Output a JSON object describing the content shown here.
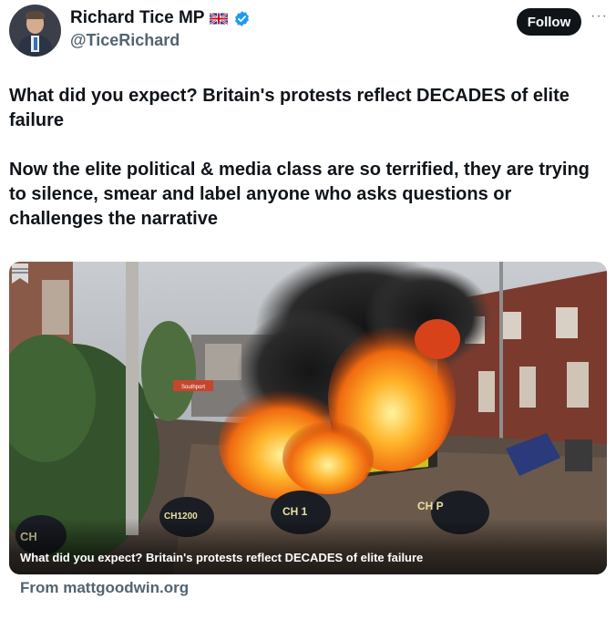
{
  "author": {
    "display_name": "Richard Tice MP",
    "handle": "@TiceRichard"
  },
  "follow_label": "Follow",
  "more_label": "···",
  "tweet": {
    "paragraphs": [
      "What did you expect? Britain's protests reflect DECADES of elite failure",
      "Now the elite political & media class are so terrified, they are trying to silence, smear and label anyone who asks questions or challenges the narrative"
    ]
  },
  "card": {
    "caption": "What did you expect? Britain's protests reflect DECADES of elite failure",
    "source": "From mattgoodwin.org",
    "image_text": {
      "road_sign": "Southport",
      "helmet_left": "CH",
      "helmet_mid": "CH 1",
      "helmet_number": "CH1200",
      "helmet_right": "CH P"
    }
  },
  "colors": {
    "primary_text": "#0f1419",
    "secondary_text": "#536471",
    "verified_blue": "#1d9bf0",
    "follow_bg": "#0f1419"
  }
}
